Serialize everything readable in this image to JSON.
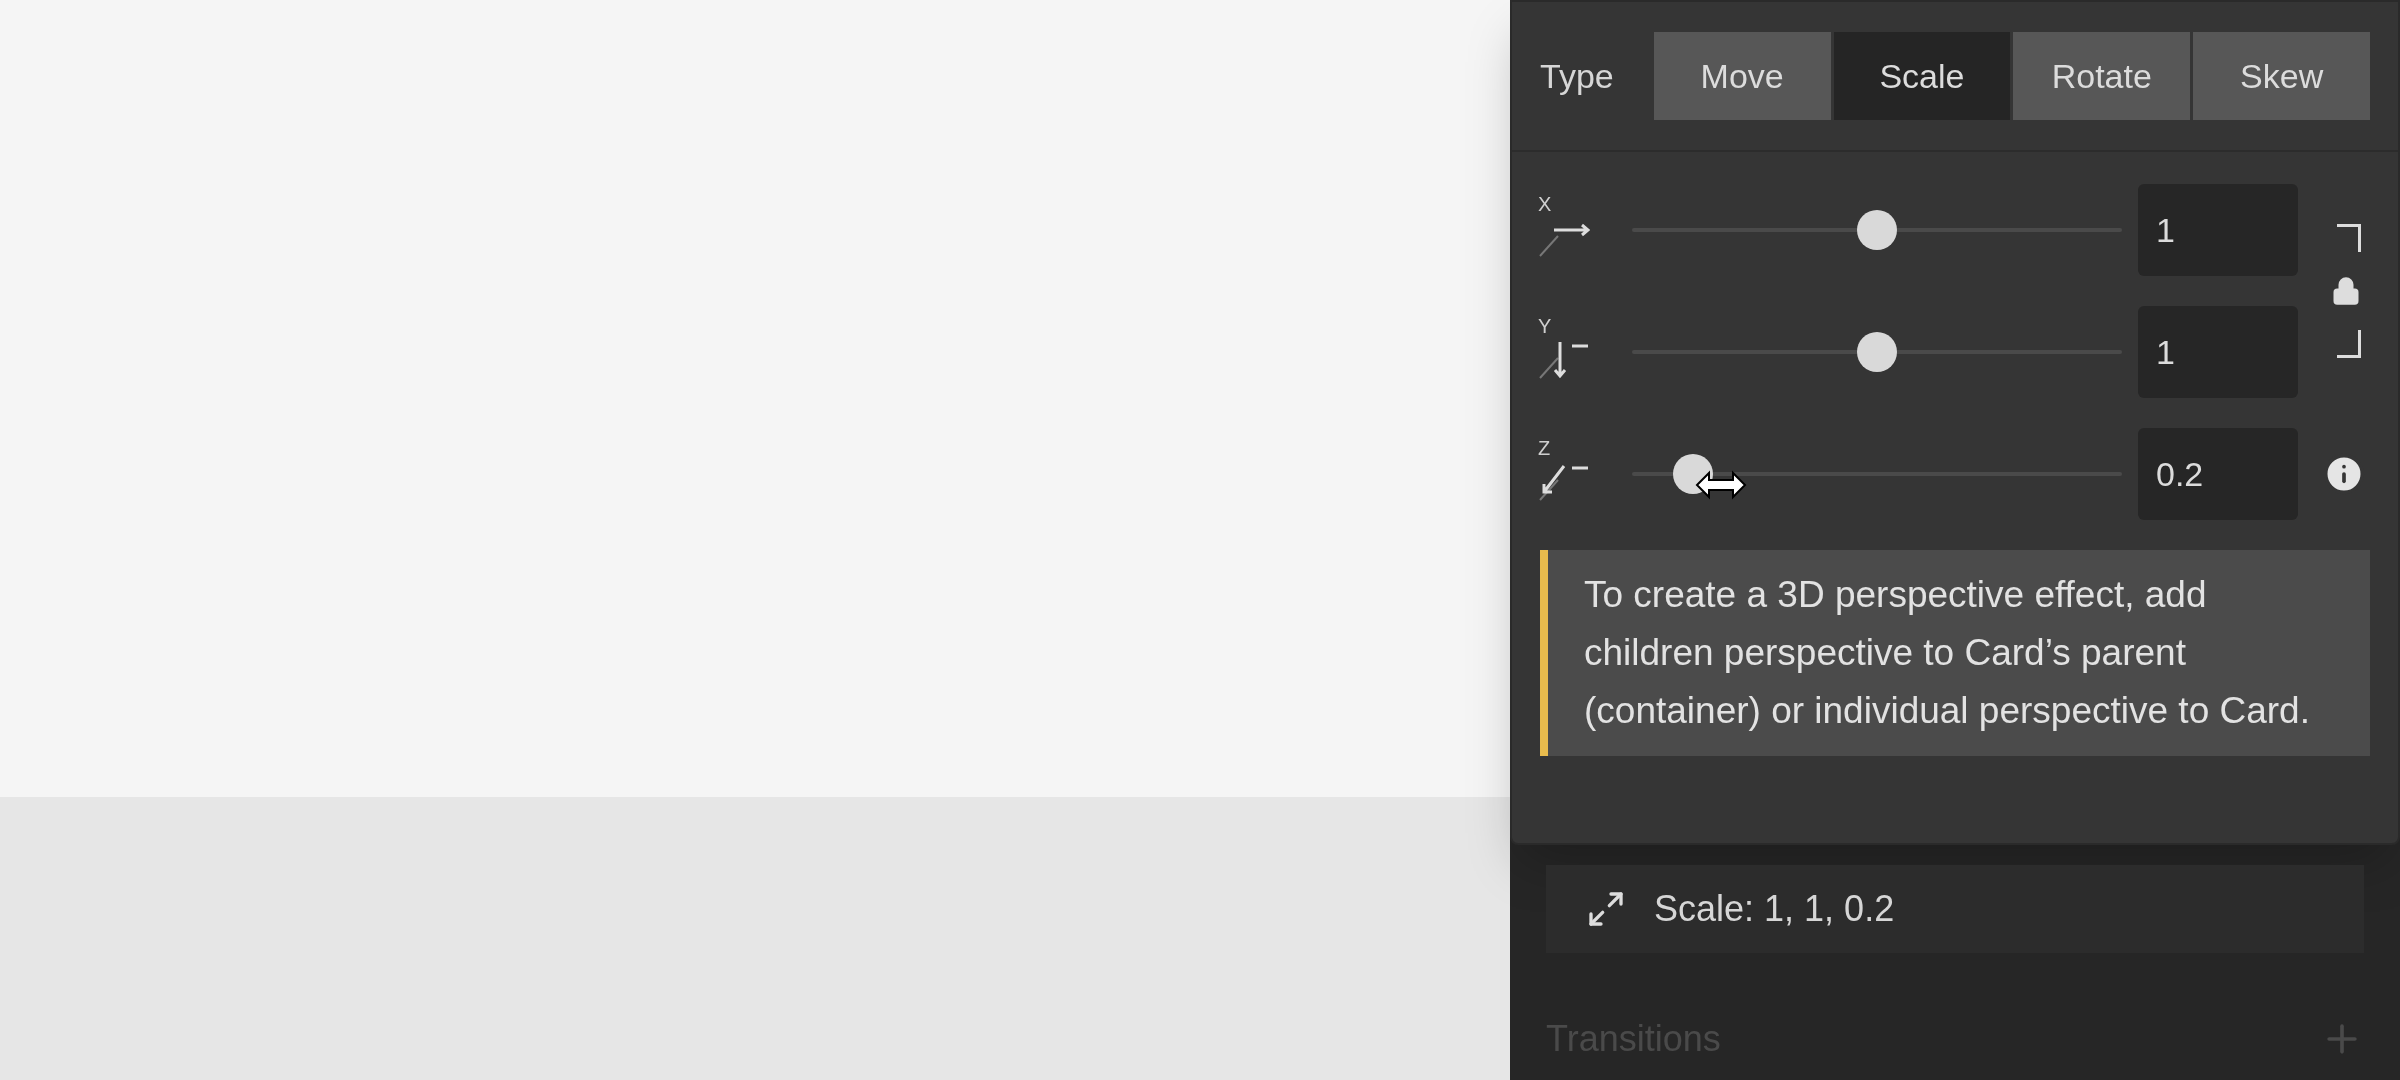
{
  "popover": {
    "type_label": "Type",
    "types": [
      {
        "label": "Move",
        "selected": false
      },
      {
        "label": "Scale",
        "selected": true
      },
      {
        "label": "Rotate",
        "selected": false
      },
      {
        "label": "Skew",
        "selected": false
      }
    ],
    "axes": [
      {
        "axis": "X",
        "kind": "linked",
        "level": 0.5,
        "value": "1"
      },
      {
        "axis": "Y",
        "kind": "linked",
        "level": 0.5,
        "value": "1"
      },
      {
        "axis": "Z",
        "kind": "info",
        "level": 0.125,
        "value": "0.2"
      }
    ],
    "note": "To create a 3D perspective effect, add children perspective to Card’s parent (container) or individual perspective to Card."
  },
  "transforms": [
    {
      "label": "Scale: 1, 1, 0.2"
    }
  ],
  "transitions": {
    "title": "Transitions"
  }
}
